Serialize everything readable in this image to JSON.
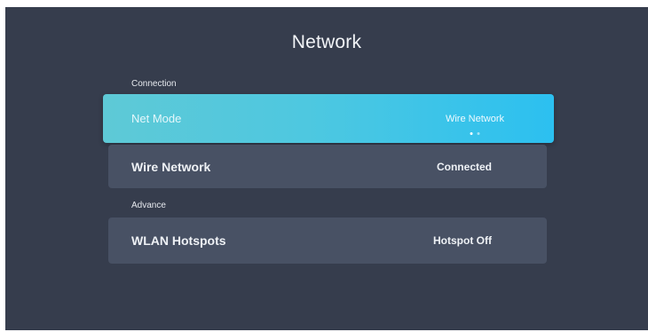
{
  "page": {
    "title": "Network"
  },
  "sections": {
    "connection": {
      "label": "Connection",
      "items": [
        {
          "label": "Net Mode",
          "value": "Wire Network",
          "focused": true,
          "indicator_dots": 2,
          "active_dot": 1
        },
        {
          "label": "Wire Network",
          "value": "Connected",
          "focused": false
        }
      ]
    },
    "advance": {
      "label": "Advance",
      "items": [
        {
          "label": "WLAN Hotspots",
          "value": "Hotspot Off",
          "focused": false
        }
      ]
    }
  },
  "colors": {
    "background": "#363d4d",
    "row": "#485164",
    "focus_gradient_start": "#5ec9d6",
    "focus_gradient_end": "#2cc0f0",
    "text": "#eef1f5"
  }
}
